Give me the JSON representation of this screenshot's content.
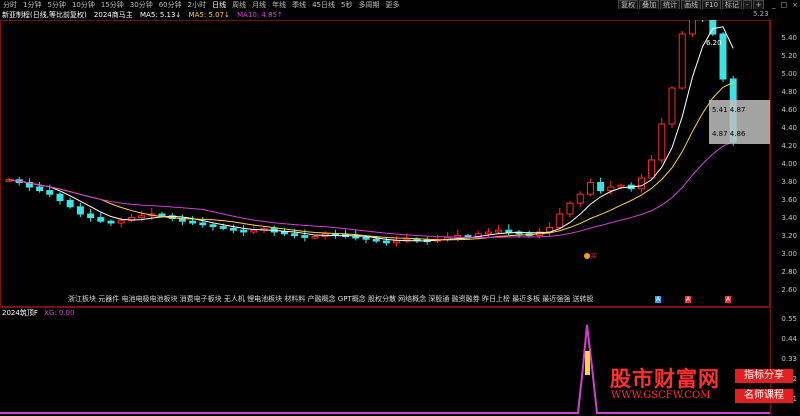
{
  "toolbar": {
    "periods": [
      "分时",
      "1分钟",
      "5分钟",
      "10分钟",
      "15分钟",
      "30分钟",
      "60分钟",
      "2小时",
      "日线",
      "周线",
      "月线",
      "年线",
      "季线",
      "45日线",
      "5秒",
      "多周期",
      "更多"
    ],
    "active_period": "日线",
    "right_buttons": [
      "复权",
      "叠加",
      "统计",
      "画线",
      "F10",
      "标记",
      "-",
      "+"
    ],
    "window_buttons": [
      "_",
      "□",
      "×"
    ]
  },
  "info": {
    "stock": "新亚制程(日线,等比前复权)",
    "indicator": "2024商马主",
    "ma1": "MA5: 5.13↓",
    "ma2": "MA5: 5.07↓",
    "ma3": "MA10: 4.85↑",
    "ma_box": "5.23"
  },
  "price_axis": [
    "5.40",
    "5.20",
    "5.00",
    "4.80",
    "4.60",
    "4.40",
    "4.20",
    "4.00",
    "3.80",
    "3.60",
    "3.40",
    "3.20",
    "3.00",
    "2.80",
    "2.60"
  ],
  "annotations": {
    "high": "6.20",
    "sel_top": "5.41 4.87",
    "sel_bottom": "4.87 4.86",
    "buy_label": "买"
  },
  "concepts": "浙江板块 元器件 电池电极电池板块 消费电子板块 无人机 锂电池板块 材料料 产融概念 GPT概念 股权分散 网络概念 深股通 融资融券 昨日上榜 最近多板 最近强强 送转股",
  "bottom_markers": [
    {
      "label": "A",
      "color": "#3aa0ff"
    },
    {
      "label": "A",
      "color": "#ff3030"
    },
    {
      "label": "A",
      "color": "#ff3030"
    },
    {
      "label": "A",
      "color": "#40c040"
    }
  ],
  "sub_indicator": {
    "label": "2024筑顶F",
    "value_label": "XG: 0.00",
    "axis": [
      "0.55",
      "0.44",
      "0.33",
      "0.22",
      "0.11"
    ]
  },
  "watermark": {
    "title": "股市财富网",
    "url": "WWW.GSCFW.COM",
    "tag1": "指标分享",
    "tag2": "名师课程"
  },
  "colors": {
    "up": "#ff2a2a",
    "down": "#40e0e0",
    "ma5": "#ffffff",
    "ma10": "#ffd040",
    "ma_long": "#d040d0",
    "grid": "#7a1010"
  },
  "chart_data": {
    "type": "candlestick",
    "candles_close": [
      3.78,
      3.75,
      3.7,
      3.66,
      3.62,
      3.55,
      3.48,
      3.4,
      3.36,
      3.32,
      3.3,
      3.33,
      3.36,
      3.38,
      3.4,
      3.38,
      3.35,
      3.32,
      3.3,
      3.28,
      3.26,
      3.24,
      3.22,
      3.2,
      3.22,
      3.24,
      3.2,
      3.18,
      3.16,
      3.14,
      3.15,
      3.18,
      3.17,
      3.15,
      3.14,
      3.12,
      3.1,
      3.08,
      3.1,
      3.12,
      3.11,
      3.1,
      3.12,
      3.14,
      3.16,
      3.15,
      3.18,
      3.2,
      3.22,
      3.2,
      3.18,
      3.16,
      3.2,
      3.25,
      3.4,
      3.52,
      3.62,
      3.75,
      3.66,
      3.7,
      3.72,
      3.68,
      3.8,
      4.0,
      4.4,
      4.8,
      5.4,
      6.0,
      5.7,
      5.4,
      4.9,
      4.2
    ]
  }
}
